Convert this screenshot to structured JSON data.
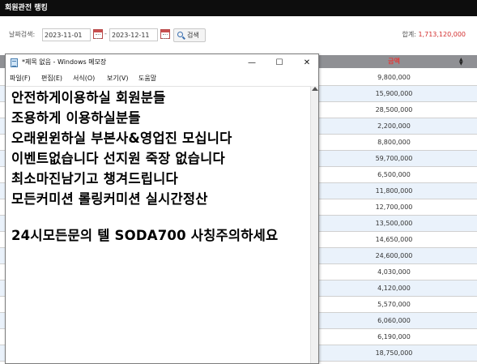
{
  "page": {
    "title": "회원관전 랭킹"
  },
  "filter": {
    "label": "날짜검색:",
    "start_date": "2023-11-01",
    "end_date": "2023-12-11",
    "separator": "-",
    "search_label": "검색",
    "total_label": "합계:",
    "total_value": "1,713,120,000"
  },
  "table": {
    "amount_header": "금액",
    "amounts": [
      "9,800,000",
      "15,900,000",
      "28,500,000",
      "2,200,000",
      "8,800,000",
      "59,700,000",
      "6,500,000",
      "11,800,000",
      "12,700,000",
      "13,500,000",
      "14,650,000",
      "24,600,000",
      "4,030,000",
      "4,120,000",
      "5,570,000",
      "6,060,000",
      "6,190,000",
      "18,750,000"
    ]
  },
  "notepad": {
    "title": "*제목 없음 - Windows 메모장",
    "minimize": "—",
    "maximize": "☐",
    "close": "✕",
    "menu": [
      "파일(F)",
      "편집(E)",
      "서식(O)",
      "보기(V)",
      "도움말"
    ],
    "lines": [
      "안전하게이용하실 회원분들",
      "조용하게 이용하실분들",
      "오래윈윈하실 부본사&영업진 모십니다",
      "이벤트없습니다 선지원 죽장 없습니다",
      "최소마진남기고 챙겨드립니다",
      "모든커미션 롤링커미션 실시간정산",
      "",
      "24시모든문의 텔 SODA700 사칭주의하세요"
    ]
  },
  "colors": {
    "topbar": "#0d0d0d",
    "header_row": "#8f9094",
    "amount_header": "#e13c3c",
    "total_value": "#d32f2f",
    "row_alt": "#eaf2fb"
  }
}
